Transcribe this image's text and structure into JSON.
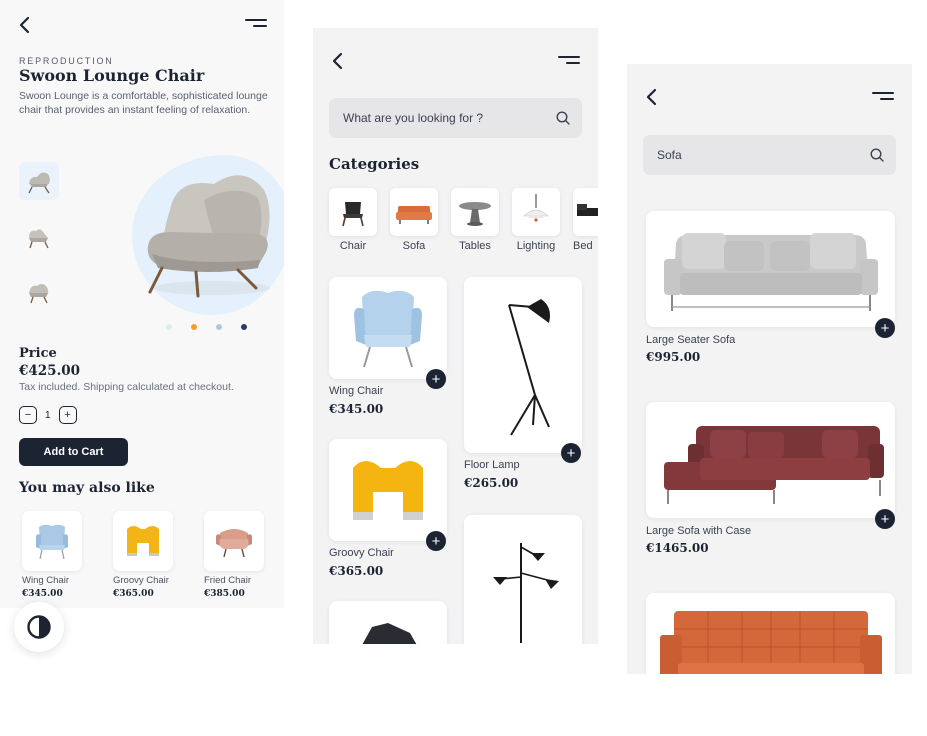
{
  "product": {
    "eyebrow": "REPRODUCTION",
    "title": "Swoon Lounge Chair",
    "description": "Swoon Lounge is a comfortable, sophisticated lounge chair that provides an instant feeling of relaxation.",
    "price_label": "Price",
    "price": "€425.00",
    "tax_note": "Tax included. Shipping calculated at checkout.",
    "quantity": "1",
    "qty_minus": "−",
    "qty_plus": "+",
    "add_to_cart": "Add to Cart",
    "related_title": "You may also like",
    "related": [
      {
        "name": "Wing Chair",
        "price": "€345.00"
      },
      {
        "name": "Groovy Chair",
        "price": "€365.00"
      },
      {
        "name": "Fried Chair",
        "price": "€385.00"
      }
    ],
    "dot_colors": [
      "#d8eef0",
      "#f0a030",
      "#a9cdd6",
      "#2d3a6e"
    ]
  },
  "catalog": {
    "search_placeholder": "What are you looking for ?",
    "categories_title": "Categories",
    "categories": [
      "Chair",
      "Sofa",
      "Tables",
      "Lighting",
      "Bed"
    ],
    "products": [
      {
        "name": "Wing Chair",
        "price": "€345.00"
      },
      {
        "name": "Floor Lamp",
        "price": "€265.00"
      },
      {
        "name": "Groovy Chair",
        "price": "€365.00"
      }
    ]
  },
  "search_results": {
    "query": "Sofa",
    "results": [
      {
        "name": "Large Seater Sofa",
        "price": "€995.00"
      },
      {
        "name": "Large Sofa with Case",
        "price": "€1465.00"
      }
    ]
  },
  "colors": {
    "accent": "#1c2433",
    "blob": "#e4f0fb",
    "search_bg": "#e6e6e8"
  },
  "icons": [
    "chevron-left-icon",
    "menu-icon",
    "search-icon",
    "plus-icon",
    "minus-icon",
    "contrast-icon"
  ]
}
